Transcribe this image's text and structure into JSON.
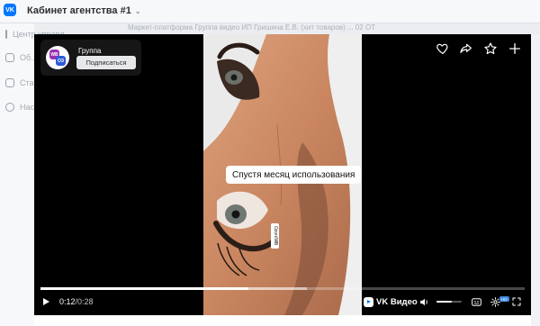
{
  "app": {
    "logo_text": "VK",
    "title": "Кабинет агентства #1"
  },
  "sidebar": {
    "items": [
      {
        "icon": "chart-icon",
        "label": "Центр управл."
      },
      {
        "icon": "folder-icon",
        "label": "Об..."
      },
      {
        "icon": "stats-icon",
        "label": "Ста..."
      },
      {
        "icon": "gear-icon",
        "label": "Нас..."
      }
    ]
  },
  "page_strip": "Маркет-платформа   Группа видео   ИП Гришина Е.В. (хит товаров)   ...   02   ОТ",
  "player": {
    "group": {
      "name": "Группа",
      "subscribe_label": "Подписаться",
      "avatar_left": "WB",
      "avatar_right": "ОЗ"
    },
    "caption": "Спустя месяц использования",
    "side_tag": "Ozon/WB",
    "current_time": "0:12",
    "separator": " / ",
    "duration": "0:28",
    "progress": 0.43,
    "buffered": 0.55,
    "volume": 0.6,
    "brand": "VK Видео",
    "quality_badge": "HD",
    "accent_color": "#0077ff"
  }
}
